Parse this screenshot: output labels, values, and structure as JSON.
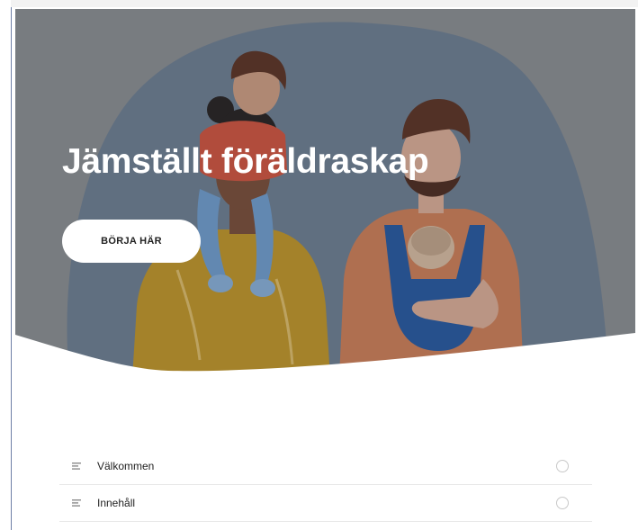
{
  "hero": {
    "title": "Jämställt föräldraskap",
    "cta_label": "BÖRJA HÄR",
    "illustration": "parents-with-children-illustration",
    "overlay_color": "#6f7477"
  },
  "lessons": [
    {
      "label": "Välkommen",
      "icon": "lines-icon",
      "status": "not-started"
    },
    {
      "label": "Innehåll",
      "icon": "lines-icon",
      "status": "not-started"
    }
  ],
  "colors": {
    "background": "#ffffff",
    "hero_blob": "#6d7f95",
    "divider": "#e8e8e8"
  }
}
